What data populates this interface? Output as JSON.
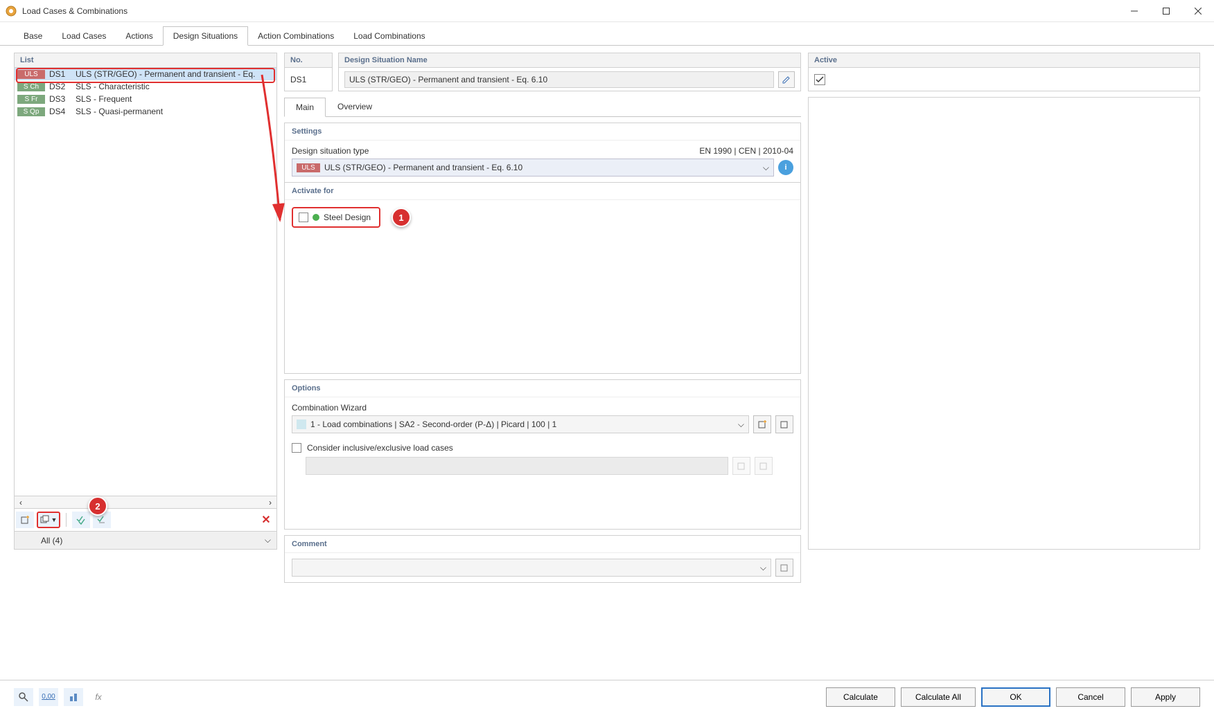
{
  "window": {
    "title": "Load Cases & Combinations"
  },
  "tabs": [
    "Base",
    "Load Cases",
    "Actions",
    "Design Situations",
    "Action Combinations",
    "Load Combinations"
  ],
  "activeTab": "Design Situations",
  "list": {
    "header": "List",
    "items": [
      {
        "badge": "ULS",
        "badgeClass": "badge-uls",
        "code": "DS1",
        "desc": "ULS (STR/GEO) - Permanent and transient - Eq."
      },
      {
        "badge": "S Ch",
        "badgeClass": "badge-sch",
        "code": "DS2",
        "desc": "SLS - Characteristic"
      },
      {
        "badge": "S Fr",
        "badgeClass": "badge-sfr",
        "code": "DS3",
        "desc": "SLS - Frequent"
      },
      {
        "badge": "S Qp",
        "badgeClass": "badge-sqp",
        "code": "DS4",
        "desc": "SLS - Quasi-permanent"
      }
    ],
    "filter": "All (4)"
  },
  "no": {
    "header": "No.",
    "value": "DS1"
  },
  "name": {
    "header": "Design Situation Name",
    "value": "ULS (STR/GEO) - Permanent and transient - Eq. 6.10"
  },
  "active": {
    "header": "Active",
    "checked": true
  },
  "subtabs": [
    "Main",
    "Overview"
  ],
  "settings": {
    "title": "Settings",
    "typeLabel": "Design situation type",
    "typeCode": "EN 1990 | CEN | 2010-04",
    "typeBadge": "ULS",
    "typeValue": "ULS (STR/GEO) - Permanent and transient - Eq. 6.10"
  },
  "activate": {
    "title": "Activate for",
    "steel": "Steel Design"
  },
  "options": {
    "title": "Options",
    "cwLabel": "Combination Wizard",
    "cwValue": "1 - Load combinations | SA2 - Second-order (P-Δ) | Picard | 100 | 1",
    "considerLabel": "Consider inclusive/exclusive load cases"
  },
  "comment": {
    "title": "Comment"
  },
  "buttons": {
    "calculate": "Calculate",
    "calculateAll": "Calculate All",
    "ok": "OK",
    "cancel": "Cancel",
    "apply": "Apply"
  },
  "annotations": {
    "one": "1",
    "two": "2"
  }
}
